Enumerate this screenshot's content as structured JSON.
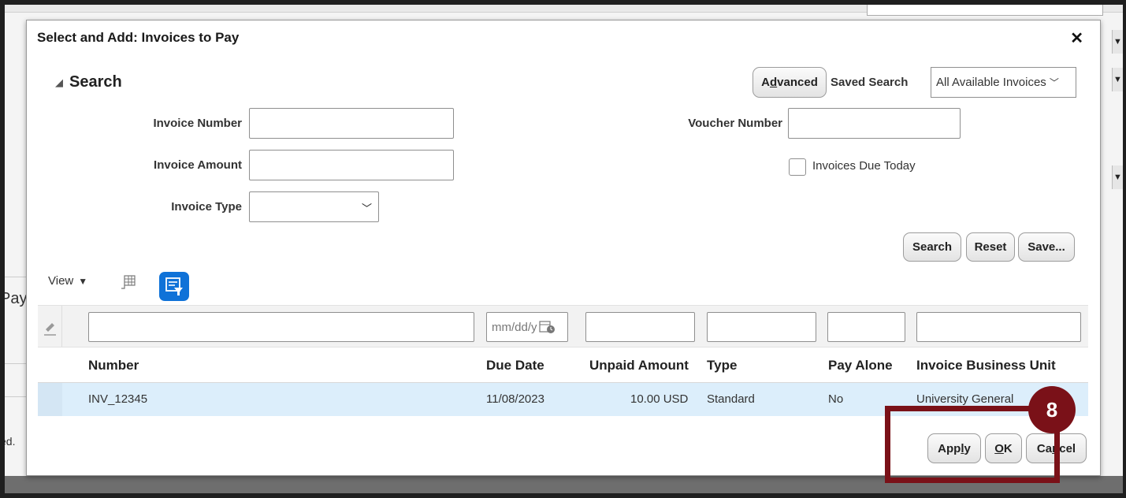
{
  "dialog": {
    "title": "Select and Add: Invoices to Pay",
    "close_glyph": "✕"
  },
  "search": {
    "title": "Search",
    "toggle_glyph": "◢",
    "advanced_pre": "A",
    "advanced_key": "d",
    "advanced_post": "vanced",
    "saved_search_label": "Saved Search",
    "saved_search_value": "All Available Invoices",
    "fields": {
      "invoice_number": "Invoice Number",
      "invoice_amount": "Invoice Amount",
      "invoice_type": "Invoice Type",
      "voucher_number": "Voucher Number",
      "invoices_due_today": "Invoices Due Today"
    },
    "buttons": {
      "search": "Search",
      "reset": "Reset",
      "save": "Save..."
    }
  },
  "toolbar": {
    "view_label": "View",
    "view_caret": "▼"
  },
  "table": {
    "date_placeholder": "mm/dd/y",
    "columns": {
      "number": "Number",
      "due_date": "Due Date",
      "unpaid_amount": "Unpaid Amount",
      "type": "Type",
      "pay_alone": "Pay Alone",
      "business_unit": "Invoice Business Unit"
    },
    "rows": [
      {
        "number": "INV_12345",
        "due_date": "11/08/2023",
        "unpaid_amount": "10.00 USD",
        "type": "Standard",
        "pay_alone": "No",
        "business_unit": "University General"
      }
    ]
  },
  "footer": {
    "apply_pre": "App",
    "apply_key": "l",
    "apply_post": "y",
    "ok_key": "O",
    "ok_post": "K",
    "cancel_pre": "Ca",
    "cancel_key": "n",
    "cancel_post": "cel"
  },
  "callout": {
    "step": "8"
  },
  "background": {
    "left_text_1": "Pay",
    "left_text_2": "ed."
  },
  "colors": {
    "accent_blue": "#0f72d8",
    "callout": "#7a1118",
    "selected_row": "#dceefb"
  }
}
